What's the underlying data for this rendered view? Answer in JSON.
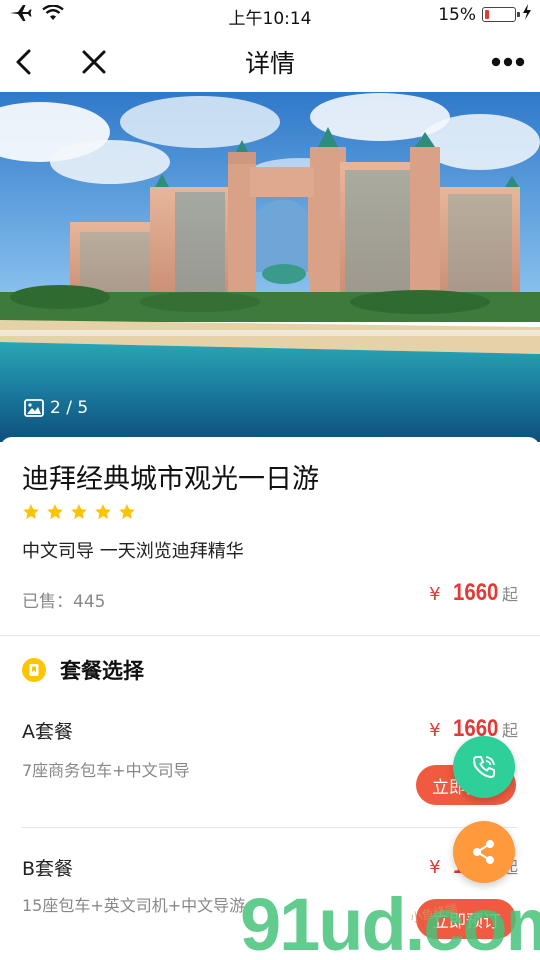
{
  "status_bar": {
    "time": "上午10:14",
    "battery": "15%",
    "battery_level": 0.15
  },
  "nav": {
    "title": "详情"
  },
  "gallery": {
    "counter": "2 / 5"
  },
  "product": {
    "title": "迪拜经典城市观光一日游",
    "rating": 5,
    "subtitle": "中文司导 一天浏览迪拜精华",
    "sold_label": "已售：",
    "sold_count": "445",
    "currency": "¥",
    "price": "1660",
    "price_suffix": "起"
  },
  "packages_section": {
    "title": "套餐选择",
    "items": [
      {
        "name": "A套餐",
        "desc": "7座商务包车+中文司导",
        "currency": "¥",
        "price": "1660",
        "suffix": "起",
        "button": "立即预订"
      },
      {
        "name": "B套餐",
        "desc": "15座包车+英文司机+中文导游",
        "currency": "¥",
        "price": "1660",
        "suffix": "起",
        "button": "立即预订"
      }
    ]
  },
  "watermark": {
    "text": "91ud.com",
    "small_text": "小鱼终端"
  },
  "colors": {
    "accent_red": "#e53935",
    "button_orange": "#ef5a40",
    "phone_green": "#2fcf9a",
    "share_orange": "#ff9a3c",
    "star_yellow": "#ffc400"
  }
}
